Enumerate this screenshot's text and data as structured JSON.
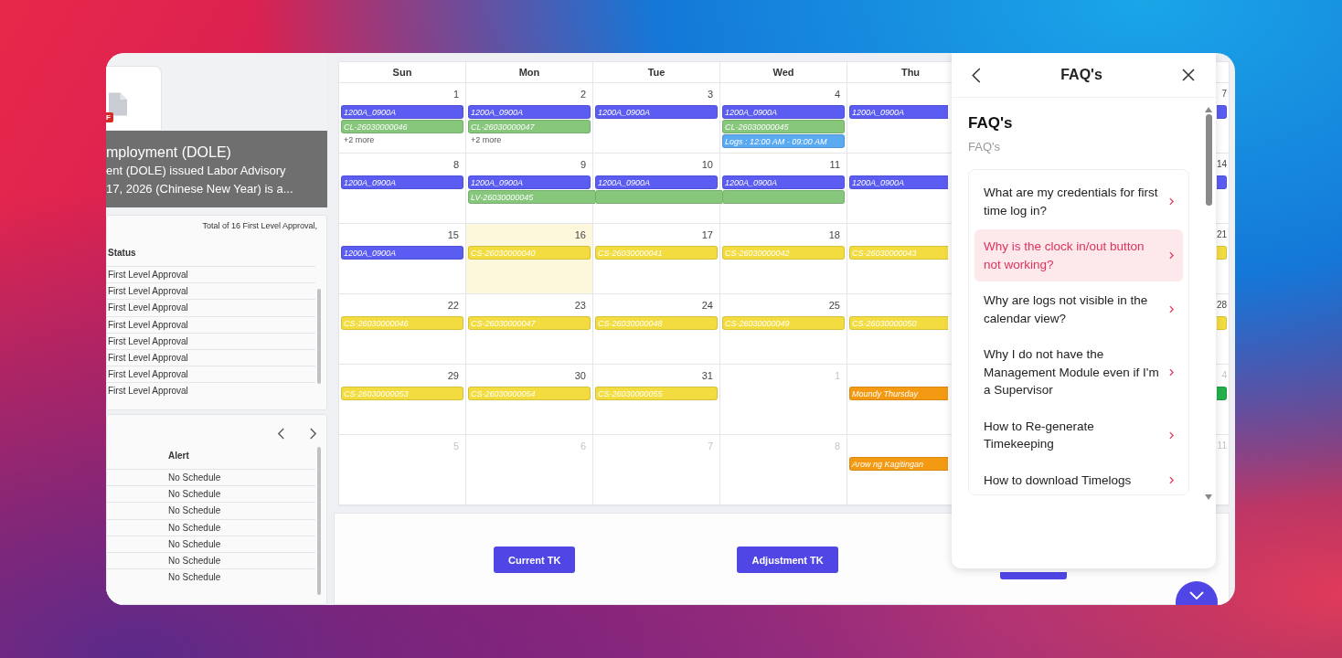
{
  "announcement": {
    "badge": "F",
    "title": "mployment (DOLE)",
    "lines": [
      "ent (DOLE) issued Labor Advisory",
      "17, 2026 (Chinese New Year) is a..."
    ]
  },
  "approvals": {
    "total": "Total of 16 First Level Approval,",
    "column": "Status",
    "rows": [
      "First Level Approval",
      "First Level Approval",
      "First Level Approval",
      "First Level Approval",
      "First Level Approval",
      "First Level Approval",
      "First Level Approval",
      "First Level Approval"
    ]
  },
  "schedule_alerts": {
    "column": "Alert",
    "rows": [
      "No Schedule",
      "No Schedule",
      "No Schedule",
      "No Schedule",
      "No Schedule",
      "No Schedule",
      "No Schedule"
    ]
  },
  "calendar": {
    "weekdays": [
      "Sun",
      "Mon",
      "Tue",
      "Wed",
      "Thu"
    ],
    "weeks": [
      {
        "days": [
          {
            "day": "1",
            "muted": false,
            "today": false,
            "events": [
              {
                "label": "1200A_0900A",
                "color": "#5b5cf2"
              },
              {
                "label": "CL-26030000046",
                "color": "#86c77b"
              }
            ],
            "more": "+2 more"
          },
          {
            "day": "2",
            "muted": false,
            "today": false,
            "events": [
              {
                "label": "1200A_0900A",
                "color": "#5b5cf2"
              },
              {
                "label": "CL-26030000047",
                "color": "#86c77b"
              }
            ],
            "more": "+2 more"
          },
          {
            "day": "3",
            "muted": false,
            "today": false,
            "events": [
              {
                "label": "1200A_0900A",
                "color": "#5b5cf2"
              }
            ]
          },
          {
            "day": "4",
            "muted": false,
            "today": false,
            "events": [
              {
                "label": "1200A_0900A",
                "color": "#5b5cf2"
              },
              {
                "label": "CL-26030000045",
                "color": "#86c77b"
              },
              {
                "label": "Logs : 12:00 AM - 09:00 AM",
                "color": "#5aaaf2"
              }
            ]
          },
          {
            "events": [
              {
                "label": "1200A_0900A",
                "color": "#5b5cf2"
              }
            ]
          },
          {
            "day": "7",
            "muted": false,
            "events": [
              {
                "color": "#5b5cf2"
              }
            ]
          }
        ]
      },
      {
        "days": [
          {
            "day": "8",
            "muted": false,
            "today": false,
            "events": [
              {
                "label": "1200A_0900A",
                "color": "#5b5cf2"
              }
            ]
          },
          {
            "day": "9",
            "muted": false,
            "today": false,
            "events": [
              {
                "label": "1200A_0900A",
                "color": "#5b5cf2"
              },
              {
                "label": "LV-26030000045",
                "color": "#86c77b",
                "continues": true
              }
            ]
          },
          {
            "day": "10",
            "muted": false,
            "today": false,
            "events": [
              {
                "label": "1200A_0900A",
                "color": "#5b5cf2"
              },
              {
                "color": "#86c77b",
                "continues": true
              }
            ]
          },
          {
            "day": "11",
            "muted": false,
            "today": false,
            "events": [
              {
                "label": "1200A_0900A",
                "color": "#5b5cf2"
              },
              {
                "color": "#86c77b"
              }
            ]
          },
          {
            "events": [
              {
                "label": "1200A_0900A",
                "color": "#5b5cf2"
              }
            ]
          },
          {
            "day": "14",
            "muted": false,
            "events": [
              {
                "color": "#5b5cf2"
              }
            ]
          }
        ]
      },
      {
        "days": [
          {
            "day": "15",
            "muted": false,
            "today": false,
            "events": [
              {
                "label": "1200A_0900A",
                "color": "#5b5cf2"
              }
            ]
          },
          {
            "day": "16",
            "muted": false,
            "today": true,
            "events": [
              {
                "label": "CS-26030000040",
                "color": "#f2dc3f"
              }
            ]
          },
          {
            "day": "17",
            "muted": false,
            "today": false,
            "events": [
              {
                "label": "CS-26030000041",
                "color": "#f2dc3f"
              }
            ]
          },
          {
            "day": "18",
            "muted": false,
            "today": false,
            "events": [
              {
                "label": "CS-26030000042",
                "color": "#f2dc3f"
              }
            ]
          },
          {
            "events": [
              {
                "label": "CS-26030000043",
                "color": "#f2dc3f"
              }
            ]
          },
          {
            "day": "21",
            "muted": false,
            "events": [
              {
                "color": "#f2dc3f"
              }
            ]
          }
        ]
      },
      {
        "days": [
          {
            "day": "22",
            "muted": false,
            "today": false,
            "events": [
              {
                "label": "CS-26030000046",
                "color": "#f2dc3f"
              }
            ]
          },
          {
            "day": "23",
            "muted": false,
            "today": false,
            "events": [
              {
                "label": "CS-26030000047",
                "color": "#f2dc3f"
              }
            ]
          },
          {
            "day": "24",
            "muted": false,
            "today": false,
            "events": [
              {
                "label": "CS-26030000048",
                "color": "#f2dc3f"
              }
            ]
          },
          {
            "day": "25",
            "muted": false,
            "today": false,
            "events": [
              {
                "label": "CS-26030000049",
                "color": "#f2dc3f"
              }
            ]
          },
          {
            "events": [
              {
                "label": "CS-26030000050",
                "color": "#f2dc3f"
              }
            ]
          },
          {
            "day": "28",
            "muted": false,
            "events": [
              {
                "color": "#f2dc3f"
              }
            ]
          }
        ]
      },
      {
        "days": [
          {
            "day": "29",
            "muted": false,
            "today": false,
            "events": [
              {
                "label": "CS-26030000053",
                "color": "#f2dc3f"
              }
            ]
          },
          {
            "day": "30",
            "muted": false,
            "today": false,
            "events": [
              {
                "label": "CS-26030000054",
                "color": "#f2dc3f"
              }
            ]
          },
          {
            "day": "31",
            "muted": false,
            "today": false,
            "events": [
              {
                "label": "CS-26030000055",
                "color": "#f2dc3f"
              }
            ]
          },
          {
            "day": "1",
            "muted": true,
            "today": false
          },
          {
            "events": [
              {
                "label": "Moundy Thursday",
                "color": "#f39a12"
              }
            ]
          },
          {
            "day": "4",
            "muted": true,
            "events": [
              {
                "color": "#22b04b"
              }
            ]
          }
        ]
      },
      {
        "days": [
          {
            "day": "5",
            "muted": true,
            "today": false
          },
          {
            "day": "6",
            "muted": true,
            "today": false
          },
          {
            "day": "7",
            "muted": true,
            "today": false
          },
          {
            "day": "8",
            "muted": true,
            "today": false
          },
          {
            "events": [
              {
                "label": "Arow ng Kagitingan",
                "color": "#f39a12"
              }
            ]
          },
          {
            "day": "11",
            "muted": true
          }
        ]
      }
    ]
  },
  "actions": [
    {
      "label": "Current TK"
    },
    {
      "label": "Adjustment TK"
    }
  ],
  "faq": {
    "title": "FAQ's",
    "heading": "FAQ's",
    "subtitle": "FAQ's",
    "items": [
      {
        "question": "What are my credentials for first time log in?",
        "selected": false
      },
      {
        "question": "Why is the clock in/out button not working?",
        "selected": true
      },
      {
        "question": "Why are logs not visible in the calendar view?",
        "selected": false
      },
      {
        "question": "Why I do not have the Management Module even if I'm a Supervisor",
        "selected": false
      },
      {
        "question": "How to Re-generate Timekeeping",
        "selected": false
      },
      {
        "question": "How to download Timelogs",
        "selected": false
      }
    ]
  }
}
